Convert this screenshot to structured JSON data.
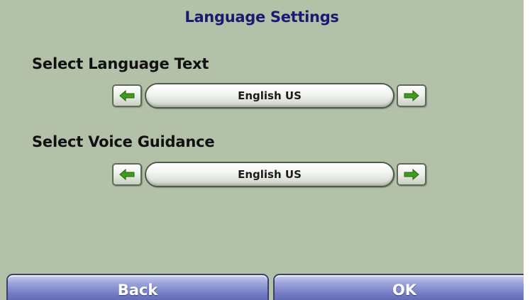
{
  "header": {
    "title": "Language Settings"
  },
  "language_text": {
    "label": "Select Language Text",
    "value": "English US"
  },
  "voice_guidance": {
    "label": "Select Voice Guidance",
    "value": "English US"
  },
  "footer": {
    "back_label": "Back",
    "ok_label": "OK"
  },
  "icons": {
    "previous": "arrow-left-icon",
    "next": "arrow-right-icon"
  },
  "colors": {
    "background": "#b3c1a9",
    "title": "#1a1a72",
    "arrow": "#3f9a1e",
    "button": "#6f78c2"
  }
}
